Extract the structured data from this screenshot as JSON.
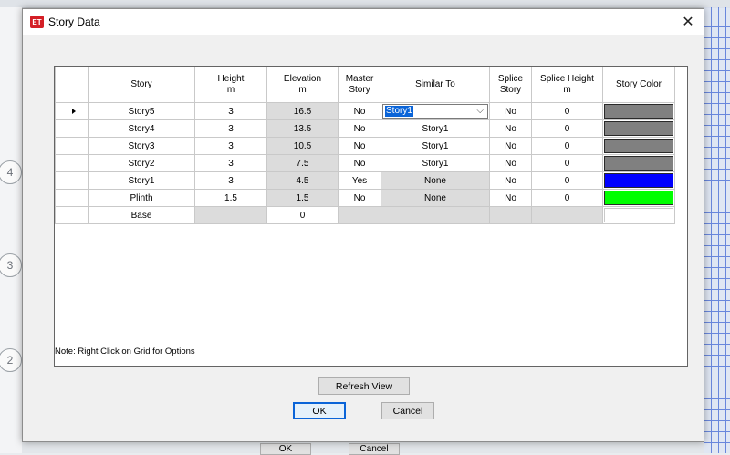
{
  "background": {
    "grid_bubbles": [
      "4",
      "3",
      "2"
    ],
    "ok_label": "OK",
    "cancel_label": "Cancel"
  },
  "dialog": {
    "icon_text": "ET",
    "title": "Story Data",
    "note": "Note:  Right Click on Grid for Options",
    "refresh_label": "Refresh View",
    "ok_label": "OK",
    "cancel_label": "Cancel"
  },
  "grid": {
    "headers": [
      {
        "line1": "Story",
        "line2": ""
      },
      {
        "line1": "Height",
        "line2": "m"
      },
      {
        "line1": "Elevation",
        "line2": "m"
      },
      {
        "line1": "Master",
        "line2": "Story"
      },
      {
        "line1": "Similar To",
        "line2": ""
      },
      {
        "line1": "Splice",
        "line2": "Story"
      },
      {
        "line1": "Splice Height",
        "line2": "m"
      },
      {
        "line1": "Story Color",
        "line2": ""
      }
    ],
    "rows": [
      {
        "story": "Story5",
        "height": "3",
        "elevation": "16.5",
        "master": "No",
        "similar": "Story1",
        "splice": "No",
        "splice_height": "0",
        "color": "#808080"
      },
      {
        "story": "Story4",
        "height": "3",
        "elevation": "13.5",
        "master": "No",
        "similar": "Story1",
        "splice": "No",
        "splice_height": "0",
        "color": "#808080"
      },
      {
        "story": "Story3",
        "height": "3",
        "elevation": "10.5",
        "master": "No",
        "similar": "Story1",
        "splice": "No",
        "splice_height": "0",
        "color": "#808080"
      },
      {
        "story": "Story2",
        "height": "3",
        "elevation": "7.5",
        "master": "No",
        "similar": "Story1",
        "splice": "No",
        "splice_height": "0",
        "color": "#808080"
      },
      {
        "story": "Story1",
        "height": "3",
        "elevation": "4.5",
        "master": "Yes",
        "similar": "None",
        "splice": "No",
        "splice_height": "0",
        "color": "#0000ff"
      },
      {
        "story": "Plinth",
        "height": "1.5",
        "elevation": "1.5",
        "master": "No",
        "similar": "None",
        "splice": "No",
        "splice_height": "0",
        "color": "#00ff00"
      },
      {
        "story": "Base",
        "height": "",
        "elevation": "0",
        "master": "",
        "similar": "",
        "splice": "",
        "splice_height": "",
        "color": "#ffffff"
      }
    ],
    "selected_row": 0
  }
}
